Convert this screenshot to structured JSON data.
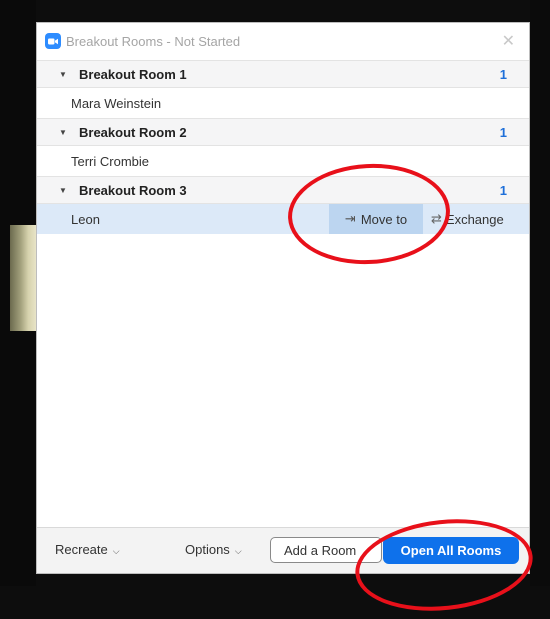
{
  "window": {
    "title": "Breakout Rooms - Not Started"
  },
  "rooms": [
    {
      "name": "Breakout Room 1",
      "count": "1",
      "participants": [
        "Mara Weinstein"
      ]
    },
    {
      "name": "Breakout Room 2",
      "count": "1",
      "participants": [
        "Terri Crombie"
      ]
    },
    {
      "name": "Breakout Room 3",
      "count": "1",
      "participants": [
        "Leon"
      ]
    }
  ],
  "row_actions": {
    "move_to": "Move to",
    "exchange": "Exchange"
  },
  "footer": {
    "recreate": "Recreate",
    "options": "Options",
    "add_room": "Add a Room",
    "open_all": "Open All Rooms"
  },
  "icons": {
    "app": "zoom-camera-icon",
    "close": "close-icon",
    "caret": "caret-down-icon",
    "move": "move-to-icon",
    "exchange": "exchange-icon"
  },
  "colors": {
    "accent": "#0e71eb",
    "count": "#1e6fd9",
    "selected_row": "#dce9f8",
    "move_highlight": "#bcd5f0",
    "annotation": "#e8101a"
  }
}
